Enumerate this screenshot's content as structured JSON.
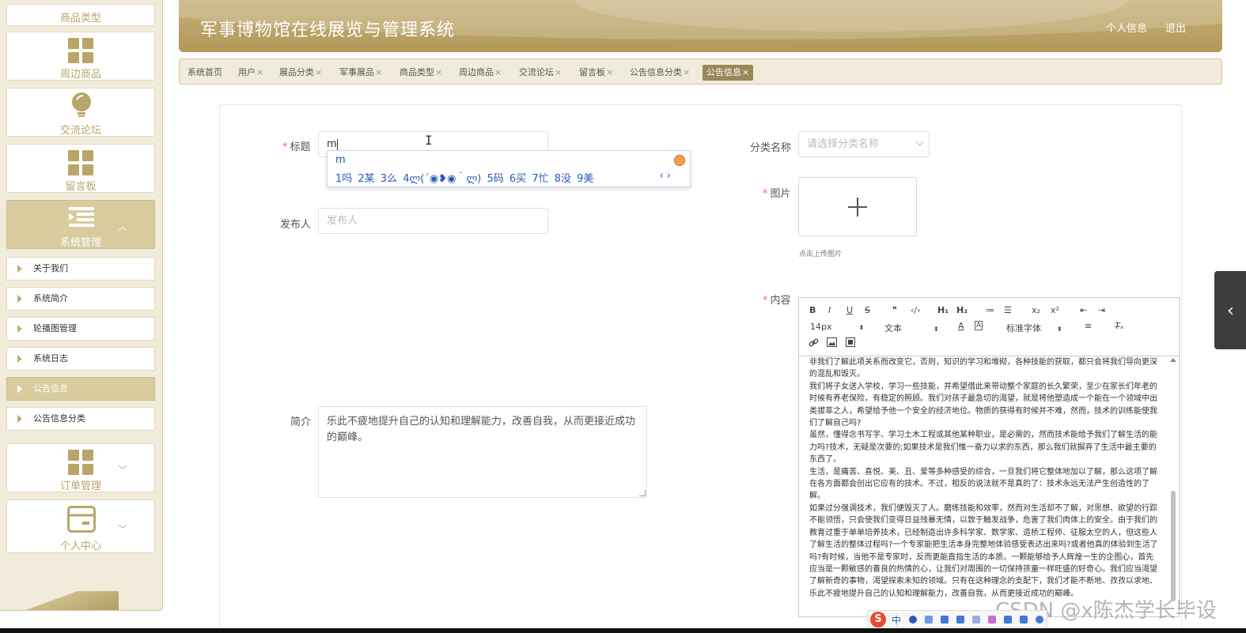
{
  "app": {
    "title": "军事博物馆在线展览与管理系统",
    "profile_link": "个人信息",
    "logout_link": "退出"
  },
  "sidebar": {
    "top_card": "商品类型",
    "cards": [
      {
        "label": "周边商品",
        "icon": "grid-icon"
      },
      {
        "label": "交流论坛",
        "icon": "lightbulb-icon"
      },
      {
        "label": "留言板",
        "icon": "grid-icon"
      },
      {
        "label": "系统管理",
        "icon": "menu-indent-icon"
      }
    ],
    "submenu": [
      "关于我们",
      "系统简介",
      "轮播图管理",
      "系统日志",
      "公告信息",
      "公告信息分类"
    ],
    "bottom_cards": [
      {
        "label": "订单管理",
        "icon": "grid-icon"
      },
      {
        "label": "个人中心",
        "icon": "wallet-icon"
      }
    ]
  },
  "tabs": [
    {
      "label": "系统首页",
      "closable": false
    },
    {
      "label": "用户",
      "closable": true
    },
    {
      "label": "展品分类",
      "closable": true
    },
    {
      "label": "军事展品",
      "closable": true
    },
    {
      "label": "商品类型",
      "closable": true
    },
    {
      "label": "周边商品",
      "closable": true
    },
    {
      "label": "交流论坛",
      "closable": true
    },
    {
      "label": "留言板",
      "closable": true
    },
    {
      "label": "公告信息分类",
      "closable": true
    },
    {
      "label": "公告信息",
      "closable": true,
      "active": true
    }
  ],
  "tab_close_glyph": "×",
  "form": {
    "title_label": "标题",
    "title_value": "m",
    "publisher_label": "发布人",
    "publisher_placeholder": "发布人",
    "category_label": "分类名称",
    "category_placeholder": "请选择分类名称",
    "image_label": "图片",
    "upload_tip": "点击上传图片",
    "content_label": "内容",
    "intro_label": "简介",
    "intro_value": "乐此不疲地提升自己的认知和理解能力，改善自我，从而更接近成功的巅峰。"
  },
  "ime": {
    "composition": "m",
    "candidates": "1吗  2某  3么  4ლ(´◉❥◉｀ლ)  5码  6买  7忙  8没  9美",
    "nav": "‹ ›"
  },
  "editor": {
    "toolbar_row1": [
      "B",
      "I",
      "U",
      "S",
      "❞",
      "‹/›",
      "H₁",
      "H₂",
      "≔",
      "☰",
      "x₂",
      "x²",
      "⇤",
      "⇥"
    ],
    "font_size": "14px",
    "text_type": "文本",
    "font_family": "标准字体",
    "content": "非我们了解此项关系而改变它，否则，知识的学习和堆砌，各种技能的获取，都只会将我们导向更深的混乱和毁灭。\n我们将子女送入学校，学习一些技能，并希望借此来带动整个家庭的长久繁荣，至少在家长们年老的时候有养老保险，有稳定的照顾。我们对孩子最急切的渴望，就是将他塑造成一个能在一个领域中出类拔萃之人，希望给予他一个安全的经济地位。物质的获得有时候并不难，然而，技术的训练能使我们了解自己吗?\n虽然，懂得念书写字、学习土木工程或其他某种职业，是必需的，然而技术能给予我们了解生活的能力吗?技术，无疑是次要的;如果技术是我们惟一奋力以求的东西，那么我们就摒弃了生活中最主要的东西了。\n生活，是痛苦、喜悦、美、丑、爱等多种感受的综合，一旦我们将它整体地加以了解，那么这项了解在各方面都会创出它应有的技术。不过，相反的说法就不是真的了：技术永远无法产生创造性的了解。\n如果过分强调技术，我们便毁灭了人。磨练技能和效率，然而对生活却不了解，对思想、欲望的行踪不能领悟，只会使我们变得日益残暴无情，以致于触发战争，危害了我们肉体上的安全。由于我们的教育过重于单单培养技术，已经制造出许多科学家、数学家、造桥工程师、征服太空的人，但这些人了解生活的整体过程吗?一个专家能把生活本身完整地体验感受表达出来吗?或者他真的体验到生活了吗?有时候，当他不是专家时，反而更能直指生活的本质。一颗能够给予人辉煌一生的企图心，首先应当是一颗敏感的善良的热情的心，让我们对周围的一切保持孩童一样旺盛的好奇心。我们应当渴望了解新奇的事物，渴望探索未知的领域。只有在这种理念的支配下，我们才能不断地、孜孜以求地、乐此不疲地提升自己的认知和理解能力，改善自我，从而更接近成功的巅峰。"
  },
  "watermark": "CSDN @x陈杰学长毕设",
  "imebar": {
    "logo": "S",
    "lang": "中"
  },
  "side_toggle": "‹",
  "colors": {
    "accent": "#b39858",
    "sidebar_bg": "#f1ebdb",
    "active_tab": "#9a875a",
    "required": "#f56c6c"
  }
}
